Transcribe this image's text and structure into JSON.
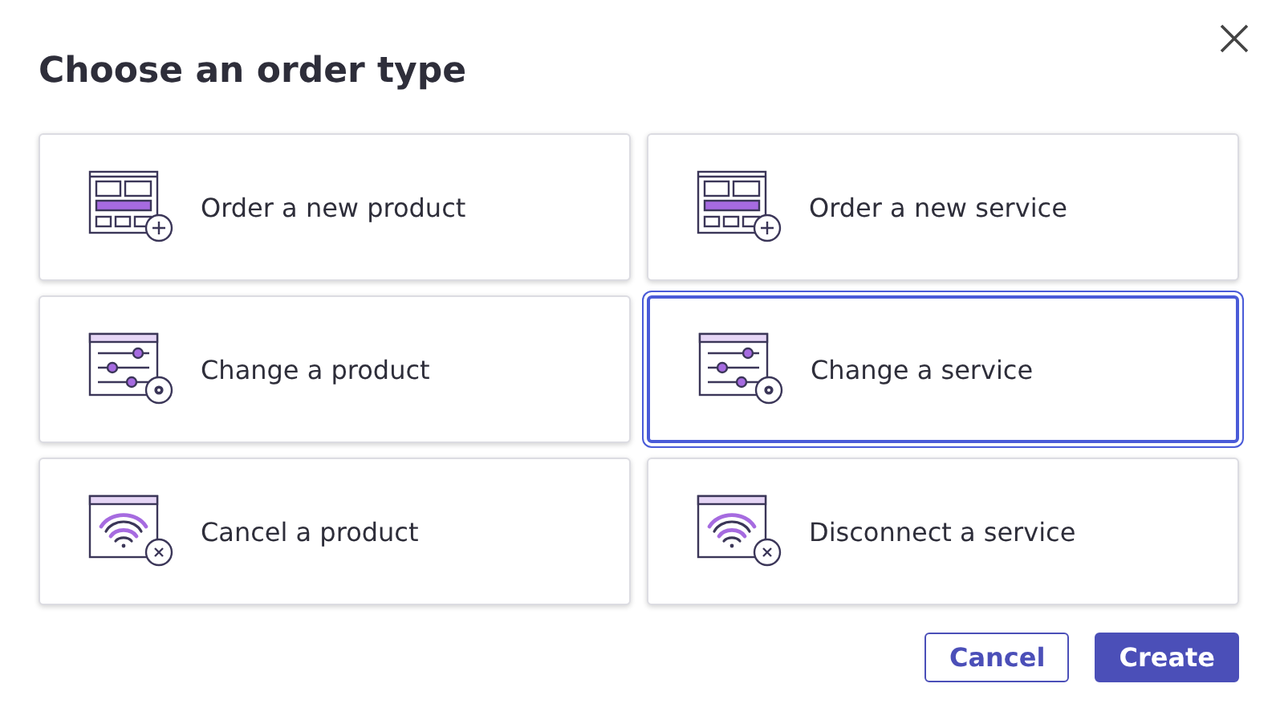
{
  "title": "Choose an order type",
  "options": [
    {
      "label": "Order a new product",
      "kind": "new",
      "selected": false
    },
    {
      "label": "Order a new service",
      "kind": "new",
      "selected": false
    },
    {
      "label": "Change a product",
      "kind": "change",
      "selected": false
    },
    {
      "label": "Change a service",
      "kind": "change",
      "selected": true
    },
    {
      "label": "Cancel a product",
      "kind": "cancel",
      "selected": false
    },
    {
      "label": "Disconnect a service",
      "kind": "cancel",
      "selected": false
    }
  ],
  "buttons": [
    {
      "label": "Cancel",
      "kind": "secondary"
    },
    {
      "label": "Create",
      "kind": "primary"
    }
  ]
}
